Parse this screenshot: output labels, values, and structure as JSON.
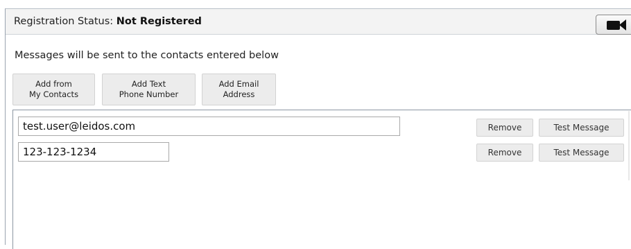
{
  "registration": {
    "label": "Registration Status:",
    "value": "Not Registered",
    "video_icon": "video-camera-icon"
  },
  "info_text": "Messages will be sent to the contacts entered below",
  "add_buttons": [
    {
      "line1": "Add from",
      "line2": "My Contacts"
    },
    {
      "line1": "Add Text",
      "line2": "Phone Number"
    },
    {
      "line1": "Add Email",
      "line2": "Address"
    }
  ],
  "contacts": [
    {
      "value": "test.user@leidos.com",
      "remove_label": "Remove",
      "test_label": "Test Message"
    },
    {
      "value": "123-123-1234",
      "remove_label": "Remove",
      "test_label": "Test Message"
    }
  ]
}
